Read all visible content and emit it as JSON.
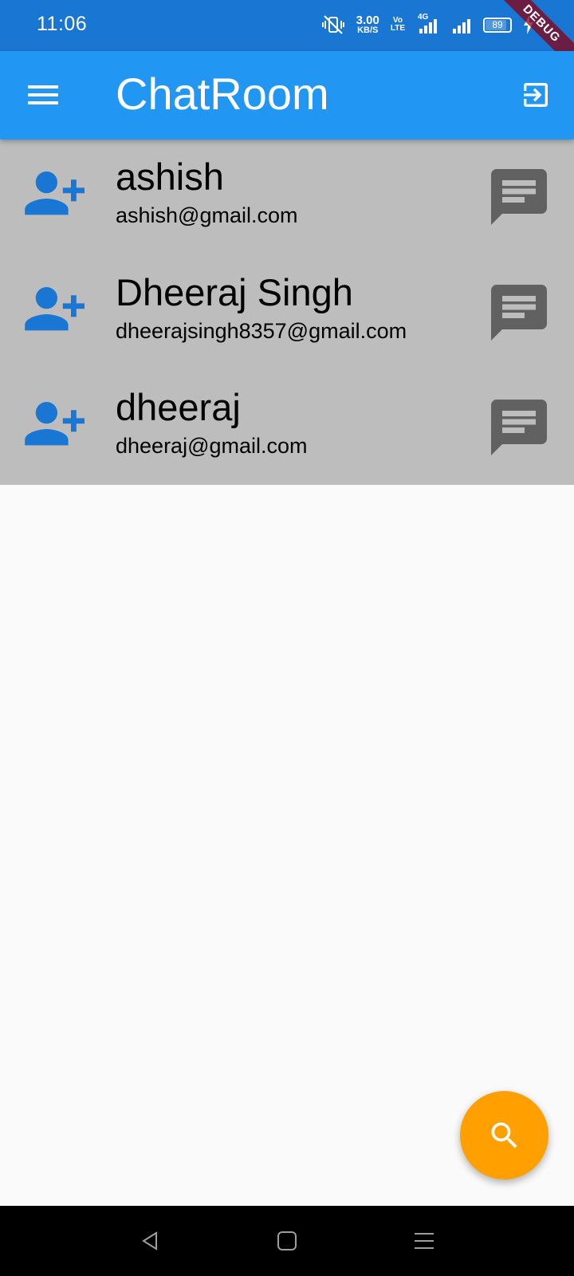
{
  "status_bar": {
    "time": "11:06",
    "net_speed_value": "3.00",
    "net_speed_unit": "KB/S",
    "volte_line1": "Vo",
    "volte_line2": "LTE",
    "network_type": "4G",
    "battery_level": "89",
    "icons": [
      "vibrate-mute-icon",
      "network-speed-indicator",
      "volte-icon",
      "signal-4g-icon",
      "signal-icon",
      "battery-icon",
      "charging-icon"
    ]
  },
  "debug_banner": "DEBUG",
  "app_bar": {
    "title": "ChatRoom",
    "menu_icon": "hamburger-menu-icon",
    "logout_icon": "logout-icon"
  },
  "users": [
    {
      "name": "ashish",
      "email": "ashish@gmail.com"
    },
    {
      "name": "Dheeraj Singh",
      "email": "dheerajsingh8357@gmail.com"
    },
    {
      "name": "dheeraj",
      "email": "dheeraj@gmail.com"
    }
  ],
  "fab": {
    "icon": "search-icon"
  },
  "nav_bar": {
    "icons": [
      "back-icon",
      "home-icon",
      "recents-icon"
    ]
  },
  "colors": {
    "status_bar": "#1976d2",
    "app_bar": "#2196f3",
    "list_background": "#bdbdbd",
    "add_user_icon": "#1976d2",
    "chat_icon": "#616161",
    "fab": "#ffa000",
    "background": "#fafafa"
  }
}
